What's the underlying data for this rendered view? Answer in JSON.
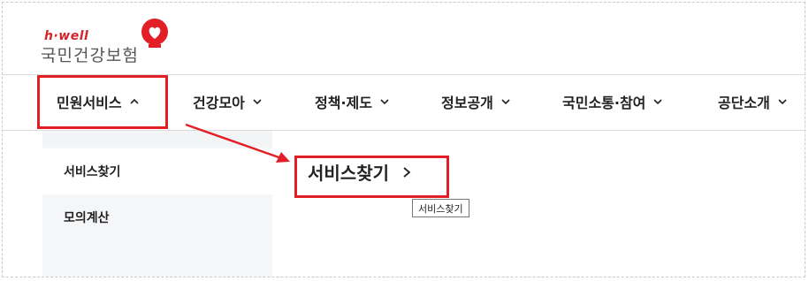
{
  "logo": {
    "tagline": "h·well",
    "name": "국민건강보험"
  },
  "nav": {
    "items": [
      {
        "label": "민원서비스",
        "expanded": true
      },
      {
        "label": "건강모아",
        "expanded": false
      },
      {
        "label": "정책·제도",
        "expanded": false
      },
      {
        "label": "정보공개",
        "expanded": false
      },
      {
        "label": "국민소통·참여",
        "expanded": false
      },
      {
        "label": "공단소개",
        "expanded": false
      }
    ]
  },
  "submenu": {
    "items": [
      {
        "label": "서비스찾기",
        "active": true
      },
      {
        "label": "모의계산",
        "active": false
      }
    ]
  },
  "content": {
    "title": "서비스찾기",
    "tooltip": "서비스찾기"
  },
  "colors": {
    "highlight": "#e21f26",
    "brand_red": "#d6232a",
    "panel_bg": "#f5f6f8"
  },
  "icons": {
    "nav_expanded": "chevron-up-icon",
    "nav_collapsed": "chevron-down-icon",
    "content_link": "chevron-right-icon"
  }
}
